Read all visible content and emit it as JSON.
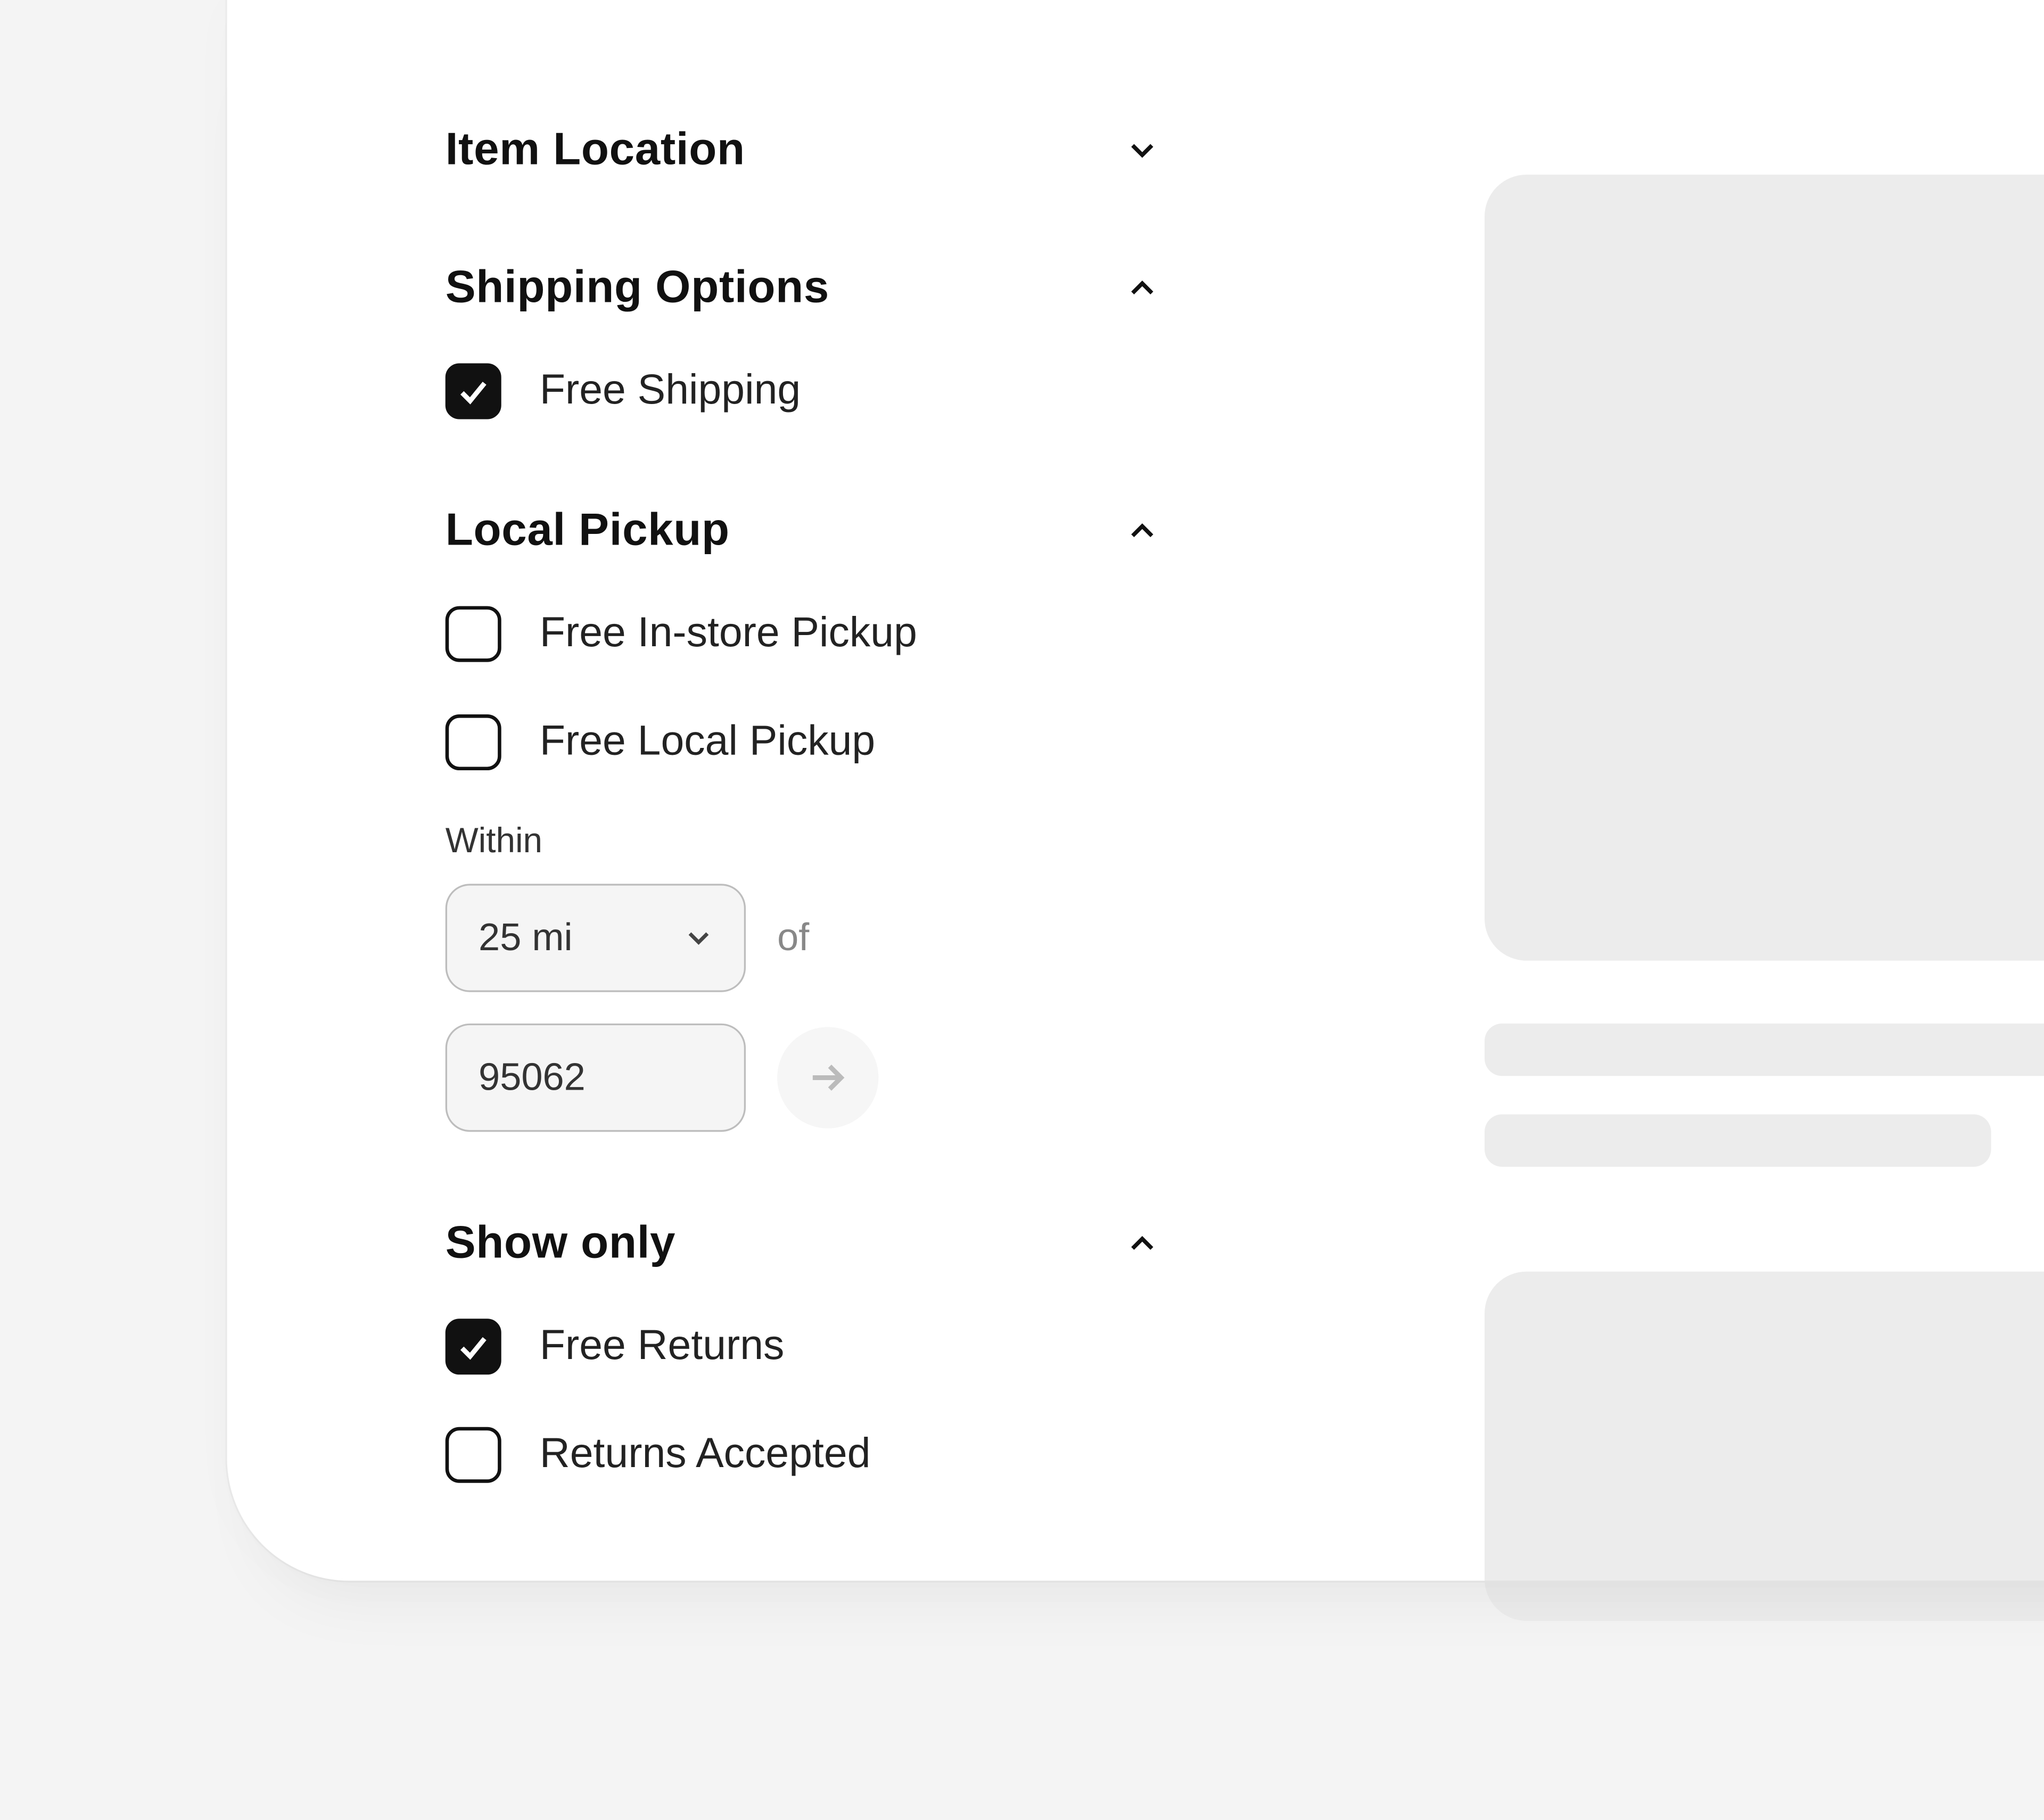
{
  "filters": {
    "item_location": {
      "title": "Item Location"
    },
    "shipping_options": {
      "title": "Shipping Options",
      "free_shipping": {
        "label": "Free Shipping",
        "checked": true
      }
    },
    "local_pickup": {
      "title": "Local Pickup",
      "free_instore": {
        "label": "Free In-store Pickup",
        "checked": false
      },
      "free_local": {
        "label": "Free Local Pickup",
        "checked": false
      },
      "within_label": "Within",
      "distance_value": "25 mi",
      "of_label": "of",
      "zip_value": "95062"
    },
    "show_only": {
      "title": "Show only",
      "free_returns": {
        "label": "Free Returns",
        "checked": true
      },
      "returns_accepted": {
        "label": "Returns Accepted",
        "checked": false
      }
    }
  }
}
